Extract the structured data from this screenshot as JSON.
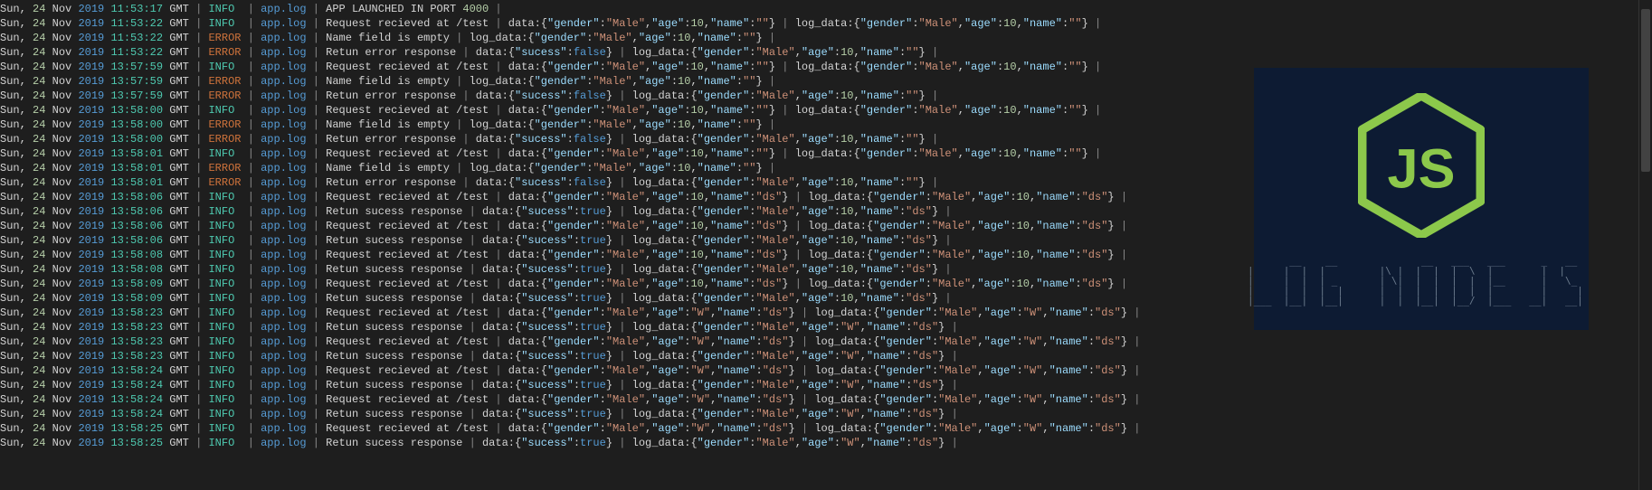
{
  "colors": {
    "bg": "#1e1e1e",
    "badge_bg": "#0d1b33",
    "accent": "#8cc84b",
    "ascii": "#6a7a8c"
  },
  "scrollbar": {
    "present": true
  },
  "badge": {
    "logo": "nodejs-hexagon",
    "text_letters": "JS",
    "ascii_title": "Log Nodejs"
  },
  "common": {
    "dow": "Sun,",
    "day": "24",
    "mon": "Nov",
    "year": "2019",
    "tz": "GMT",
    "pipe": "|",
    "file": "app.log",
    "data10": {
      "gender": "Male",
      "age": 10,
      "name": ""
    },
    "data10ds": {
      "gender": "Male",
      "age": 10,
      "name": "ds"
    },
    "dataW": {
      "gender": "Male",
      "age": "W",
      "name": "ds"
    },
    "sucF": {
      "sucess": false
    },
    "sucT": {
      "sucess": true
    }
  },
  "lines": [
    {
      "t": "11:53:17",
      "lvl": "INFO",
      "kind": "launch",
      "port": 4000
    },
    {
      "t": "11:53:22",
      "lvl": "INFO",
      "kind": "req",
      "d": "data10",
      "ld": "data10"
    },
    {
      "t": "11:53:22",
      "lvl": "ERROR",
      "kind": "empty",
      "ld": "data10"
    },
    {
      "t": "11:53:22",
      "lvl": "ERROR",
      "kind": "errresp",
      "d": "sucF",
      "ld": "data10"
    },
    {
      "t": "13:57:59",
      "lvl": "INFO",
      "kind": "req",
      "d": "data10",
      "ld": "data10"
    },
    {
      "t": "13:57:59",
      "lvl": "ERROR",
      "kind": "empty",
      "ld": "data10"
    },
    {
      "t": "13:57:59",
      "lvl": "ERROR",
      "kind": "errresp",
      "d": "sucF",
      "ld": "data10"
    },
    {
      "t": "13:58:00",
      "lvl": "INFO",
      "kind": "req",
      "d": "data10",
      "ld": "data10"
    },
    {
      "t": "13:58:00",
      "lvl": "ERROR",
      "kind": "empty",
      "ld": "data10"
    },
    {
      "t": "13:58:00",
      "lvl": "ERROR",
      "kind": "errresp",
      "d": "sucF",
      "ld": "data10"
    },
    {
      "t": "13:58:01",
      "lvl": "INFO",
      "kind": "req",
      "d": "data10",
      "ld": "data10"
    },
    {
      "t": "13:58:01",
      "lvl": "ERROR",
      "kind": "empty",
      "ld": "data10"
    },
    {
      "t": "13:58:01",
      "lvl": "ERROR",
      "kind": "errresp",
      "d": "sucF",
      "ld": "data10"
    },
    {
      "t": "13:58:06",
      "lvl": "INFO",
      "kind": "req",
      "d": "data10ds",
      "ld": "data10ds"
    },
    {
      "t": "13:58:06",
      "lvl": "INFO",
      "kind": "okresp",
      "d": "sucT",
      "ld": "data10ds"
    },
    {
      "t": "13:58:06",
      "lvl": "INFO",
      "kind": "req",
      "d": "data10ds",
      "ld": "data10ds"
    },
    {
      "t": "13:58:06",
      "lvl": "INFO",
      "kind": "okresp",
      "d": "sucT",
      "ld": "data10ds"
    },
    {
      "t": "13:58:08",
      "lvl": "INFO",
      "kind": "req",
      "d": "data10ds",
      "ld": "data10ds"
    },
    {
      "t": "13:58:08",
      "lvl": "INFO",
      "kind": "okresp",
      "d": "sucT",
      "ld": "data10ds"
    },
    {
      "t": "13:58:09",
      "lvl": "INFO",
      "kind": "req",
      "d": "data10ds",
      "ld": "data10ds"
    },
    {
      "t": "13:58:09",
      "lvl": "INFO",
      "kind": "okresp",
      "d": "sucT",
      "ld": "data10ds"
    },
    {
      "t": "13:58:23",
      "lvl": "INFO",
      "kind": "req",
      "d": "dataW",
      "ld": "dataW"
    },
    {
      "t": "13:58:23",
      "lvl": "INFO",
      "kind": "okresp",
      "d": "sucT",
      "ld": "dataW"
    },
    {
      "t": "13:58:23",
      "lvl": "INFO",
      "kind": "req",
      "d": "dataW",
      "ld": "dataW"
    },
    {
      "t": "13:58:23",
      "lvl": "INFO",
      "kind": "okresp",
      "d": "sucT",
      "ld": "dataW"
    },
    {
      "t": "13:58:24",
      "lvl": "INFO",
      "kind": "req",
      "d": "dataW",
      "ld": "dataW"
    },
    {
      "t": "13:58:24",
      "lvl": "INFO",
      "kind": "okresp",
      "d": "sucT",
      "ld": "dataW"
    },
    {
      "t": "13:58:24",
      "lvl": "INFO",
      "kind": "req",
      "d": "dataW",
      "ld": "dataW"
    },
    {
      "t": "13:58:24",
      "lvl": "INFO",
      "kind": "okresp",
      "d": "sucT",
      "ld": "dataW"
    },
    {
      "t": "13:58:25",
      "lvl": "INFO",
      "kind": "req",
      "d": "dataW",
      "ld": "dataW"
    },
    {
      "t": "13:58:25",
      "lvl": "INFO",
      "kind": "okresp",
      "d": "sucT",
      "ld": "dataW"
    }
  ],
  "messages": {
    "launch": "APP LAUNCHED IN PORT ",
    "req": "Request recieved at /test",
    "empty": "Name field is empty",
    "errresp": "Retun error response",
    "okresp": "Retun sucess response",
    "data": "data:",
    "log_data": "log_data:"
  }
}
